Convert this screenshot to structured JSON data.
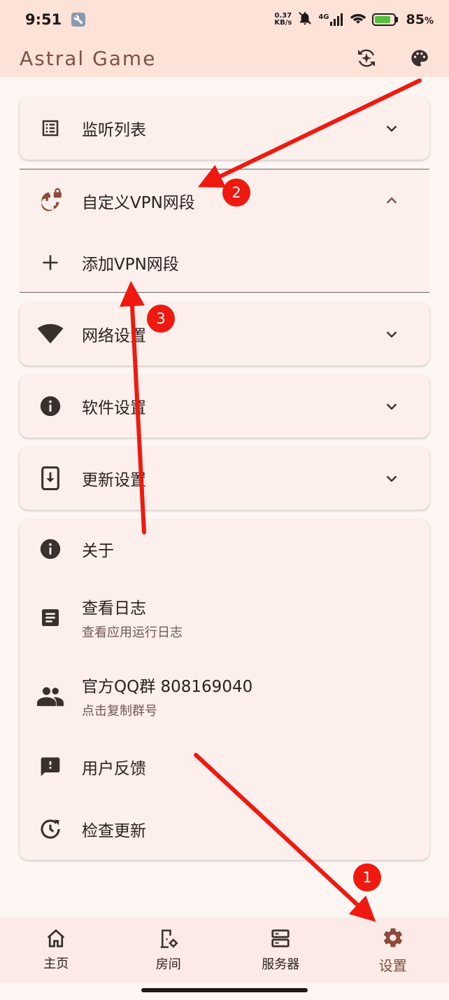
{
  "status_bar": {
    "time": "9:51",
    "net_speed_value": "0.37",
    "net_speed_unit": "KB/s",
    "network_type": "4G",
    "battery_percent": "85",
    "battery_suffix": "%",
    "battery_level": 0.85
  },
  "app_bar": {
    "title": "Astral Game",
    "actions": [
      "sparkle-refresh-icon",
      "palette-icon"
    ]
  },
  "settings": {
    "listen_list": {
      "label": "监听列表",
      "icon": "list-icon"
    },
    "custom_vpn": {
      "label": "自定义VPN网段",
      "icon": "globe-lock-icon",
      "expanded": true
    },
    "add_vpn": {
      "label": "添加VPN网段",
      "icon": "plus-icon"
    },
    "network": {
      "label": "网络设置",
      "icon": "wifi-icon"
    },
    "software": {
      "label": "软件设置",
      "icon": "info-icon"
    },
    "update": {
      "label": "更新设置",
      "icon": "phone-download-icon"
    }
  },
  "about_card": {
    "about": {
      "label": "关于",
      "icon": "info-icon"
    },
    "logs": {
      "label": "查看日志",
      "sub": "查看应用运行日志",
      "icon": "article-icon"
    },
    "qq": {
      "label": "官方QQ群 808169040",
      "sub": "点击复制群号",
      "icon": "people-icon"
    },
    "feedback": {
      "label": "用户反馈",
      "icon": "feedback-icon"
    },
    "check_update": {
      "label": "检查更新",
      "icon": "history-icon"
    }
  },
  "annotations": {
    "badge_1": "1",
    "badge_2": "2",
    "badge_3": "3",
    "color": "#f0190f"
  },
  "bottom_nav": {
    "items": [
      {
        "label": "主页",
        "icon": "home-icon"
      },
      {
        "label": "房间",
        "icon": "room-settings-icon"
      },
      {
        "label": "服务器",
        "icon": "server-icon"
      },
      {
        "label": "设置",
        "icon": "gear-icon",
        "active": true
      }
    ]
  },
  "colors": {
    "accent": "#7d5144",
    "header_bg": "#fde2d8",
    "card_bg": "#fdefeb",
    "page_bg": "#fdf6f3",
    "icon": "#3a302e"
  }
}
